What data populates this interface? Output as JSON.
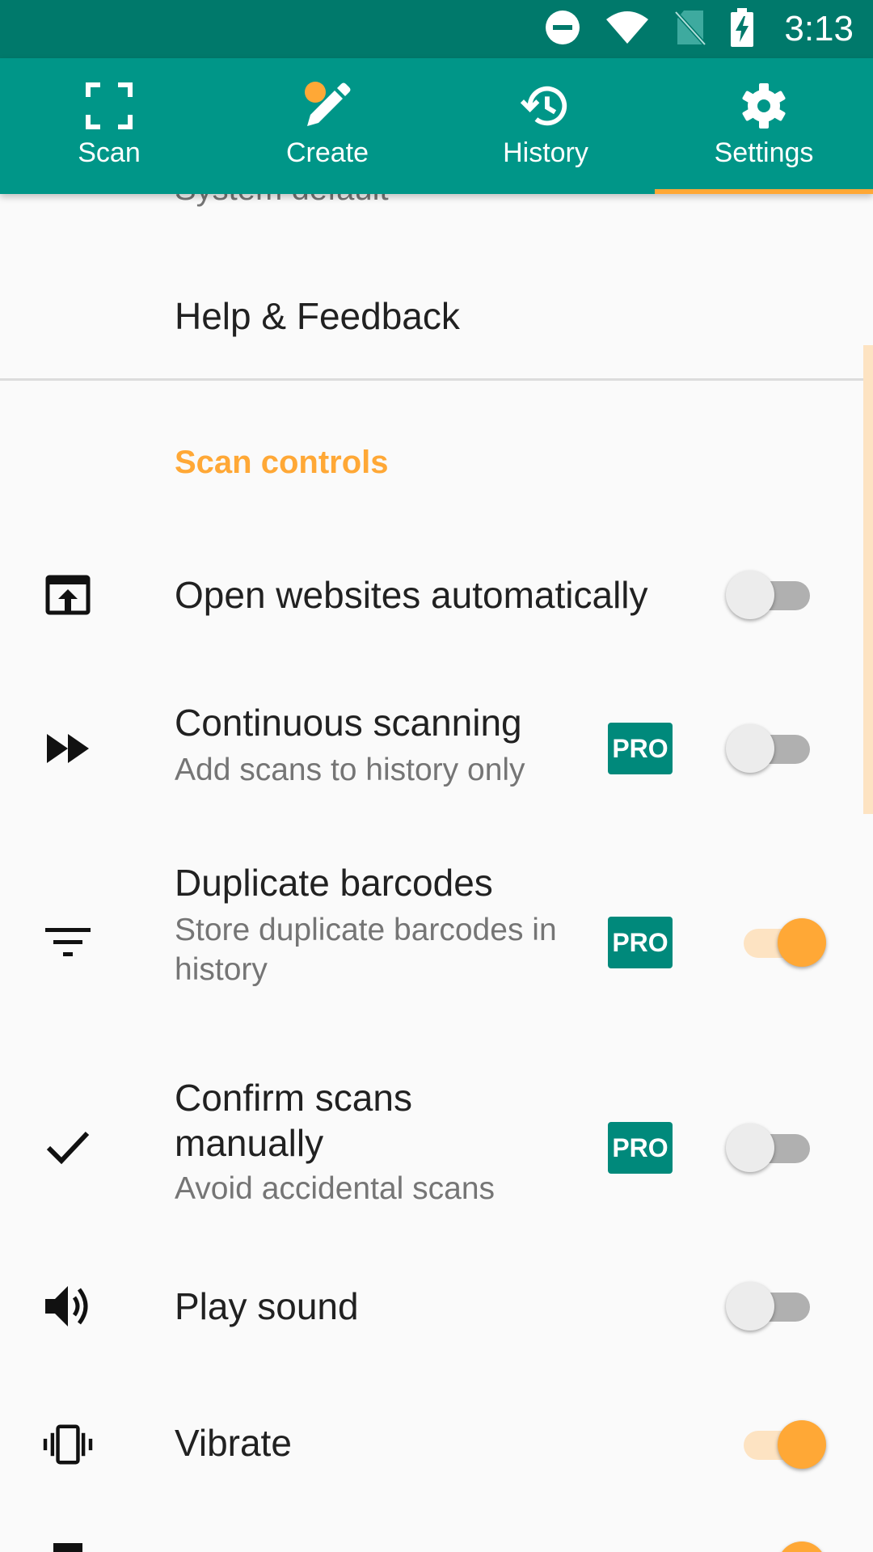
{
  "status_bar": {
    "time": "3:13",
    "icons": [
      "do-not-disturb-icon",
      "wifi-icon",
      "no-sim-icon",
      "battery-charging-icon"
    ],
    "background": "#00796b"
  },
  "tabs": [
    {
      "label": "Scan",
      "icon": "scan-frame-icon",
      "selected": false
    },
    {
      "label": "Create",
      "icon": "create-pencil-icon",
      "selected": false
    },
    {
      "label": "History",
      "icon": "history-icon",
      "selected": true
    },
    {
      "label": "Settings",
      "icon": "gear-icon",
      "selected": true
    }
  ],
  "colors": {
    "primary": "#009688",
    "primary_dark": "#00796b",
    "accent": "#ffa836",
    "pro_badge": "#00897b"
  },
  "content": {
    "cut_off_text": "System default",
    "help_label": "Help & Feedback",
    "section_header": "Scan controls",
    "settings": [
      {
        "icon": "open-in-browser-icon",
        "title": "Open websites automatically",
        "subtitle": "",
        "pro": false,
        "enabled": false
      },
      {
        "icon": "fast-forward-icon",
        "title": "Continuous scanning",
        "subtitle": "Add scans to history only",
        "pro": true,
        "enabled": false
      },
      {
        "icon": "filter-icon",
        "title": "Duplicate barcodes",
        "subtitle": "Store duplicate barcodes in history",
        "pro": true,
        "enabled": true
      },
      {
        "icon": "check-icon",
        "title": "Confirm scans manually",
        "subtitle": "Avoid accidental scans",
        "pro": true,
        "enabled": false
      },
      {
        "icon": "volume-icon",
        "title": "Play sound",
        "subtitle": "",
        "pro": false,
        "enabled": false
      },
      {
        "icon": "vibrate-icon",
        "title": "Vibrate",
        "subtitle": "",
        "pro": false,
        "enabled": true
      }
    ],
    "pro_label": "PRO"
  }
}
